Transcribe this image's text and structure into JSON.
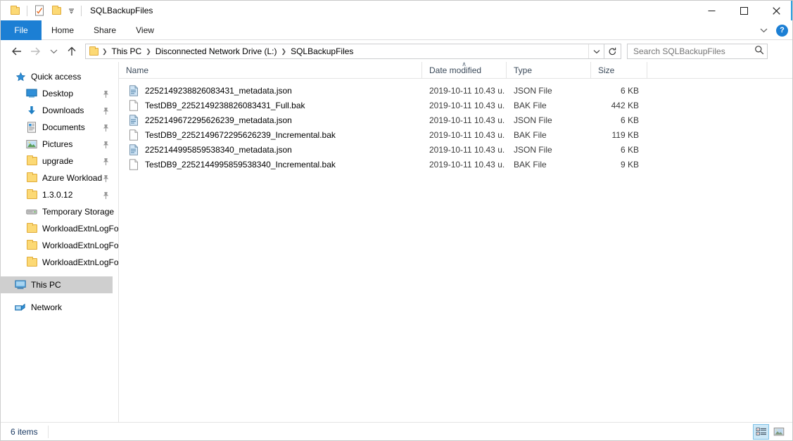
{
  "window": {
    "title": "SQLBackupFiles",
    "quick_access_toolbar": [
      {
        "name": "folder-icon",
        "label": "Properties"
      },
      {
        "name": "properties-icon",
        "label": "Properties"
      },
      {
        "name": "new-folder-icon",
        "label": "New folder"
      },
      {
        "name": "chevron-down-icon",
        "label": "Customize Quick Access Toolbar"
      }
    ],
    "controls": {
      "minimize": "—",
      "maximize": "☐",
      "close": "✕"
    }
  },
  "ribbon": {
    "tabs": [
      {
        "label": "File",
        "active": true
      },
      {
        "label": "Home",
        "active": false
      },
      {
        "label": "Share",
        "active": false
      },
      {
        "label": "View",
        "active": false
      }
    ],
    "expand_label": "⌄",
    "help_label": "?"
  },
  "address": {
    "back_label": "←",
    "forward_label": "→",
    "recent_label": "⌄",
    "up_label": "↑",
    "breadcrumbs": [
      {
        "label": "This PC"
      },
      {
        "label": "Disconnected Network Drive (L:)"
      },
      {
        "label": "SQLBackupFiles"
      }
    ],
    "separator": "❯",
    "dropdown_label": "⌄",
    "refresh_label": "↻"
  },
  "search": {
    "placeholder": "Search SQLBackupFiles",
    "icon": "search-icon"
  },
  "sidebar": {
    "groups": [
      {
        "name": "quick-access",
        "header": {
          "label": "Quick access",
          "icon": "star-icon"
        },
        "items": [
          {
            "label": "Desktop",
            "icon": "desktop-icon",
            "pinned": true
          },
          {
            "label": "Downloads",
            "icon": "download-icon",
            "pinned": true
          },
          {
            "label": "Documents",
            "icon": "documents-icon",
            "pinned": true
          },
          {
            "label": "Pictures",
            "icon": "pictures-icon",
            "pinned": true
          },
          {
            "label": "upgrade",
            "icon": "folder-icon",
            "pinned": true
          },
          {
            "label": "Azure Workload",
            "icon": "folder-icon",
            "pinned": true
          },
          {
            "label": "1.3.0.12",
            "icon": "folder-icon",
            "pinned": true
          },
          {
            "label": "Temporary Storage",
            "icon": "drive-icon",
            "pinned": false
          },
          {
            "label": "WorkloadExtnLogFo",
            "icon": "folder-icon",
            "pinned": false
          },
          {
            "label": "WorkloadExtnLogFo",
            "icon": "folder-icon",
            "pinned": false
          },
          {
            "label": "WorkloadExtnLogFo",
            "icon": "folder-icon",
            "pinned": false
          }
        ]
      }
    ],
    "this_pc": {
      "label": "This PC",
      "icon": "computer-icon",
      "selected": true
    },
    "network": {
      "label": "Network",
      "icon": "network-icon",
      "selected": false
    }
  },
  "file_list": {
    "columns": [
      {
        "key": "name",
        "label": "Name",
        "sorted": false
      },
      {
        "key": "date",
        "label": "Date modified",
        "sorted": true,
        "sort_caret": "∧"
      },
      {
        "key": "type",
        "label": "Type",
        "sorted": false
      },
      {
        "key": "size",
        "label": "Size",
        "sorted": false
      }
    ],
    "rows": [
      {
        "name": "2252149238826083431_metadata.json",
        "date": "2019-10-11 10.43 u.",
        "type": "JSON File",
        "size": "6 KB",
        "icon": "json-file-icon"
      },
      {
        "name": "TestDB9_2252149238826083431_Full.bak",
        "date": "2019-10-11 10.43 u.",
        "type": "BAK File",
        "size": "442 KB",
        "icon": "generic-file-icon"
      },
      {
        "name": "2252149672295626239_metadata.json",
        "date": "2019-10-11 10.43 u.",
        "type": "JSON File",
        "size": "6 KB",
        "icon": "json-file-icon"
      },
      {
        "name": "TestDB9_2252149672295626239_Incremental.bak",
        "date": "2019-10-11 10.43 u.",
        "type": "BAK File",
        "size": "119 KB",
        "icon": "generic-file-icon"
      },
      {
        "name": "2252144995859538340_metadata.json",
        "date": "2019-10-11 10.43 u.",
        "type": "JSON File",
        "size": "6 KB",
        "icon": "json-file-icon"
      },
      {
        "name": "TestDB9_2252144995859538340_Incremental.bak",
        "date": "2019-10-11 10.43 u.",
        "type": "BAK File",
        "size": "9 KB",
        "icon": "generic-file-icon"
      }
    ]
  },
  "status": {
    "item_count": "6 items",
    "views": [
      {
        "name": "details-view",
        "active": true
      },
      {
        "name": "large-icons-view",
        "active": false
      }
    ]
  },
  "colors": {
    "accent": "#1c7fd4",
    "selection": "#cfcfcf",
    "hover": "#e5f3fb",
    "folder": "#fcd975"
  }
}
